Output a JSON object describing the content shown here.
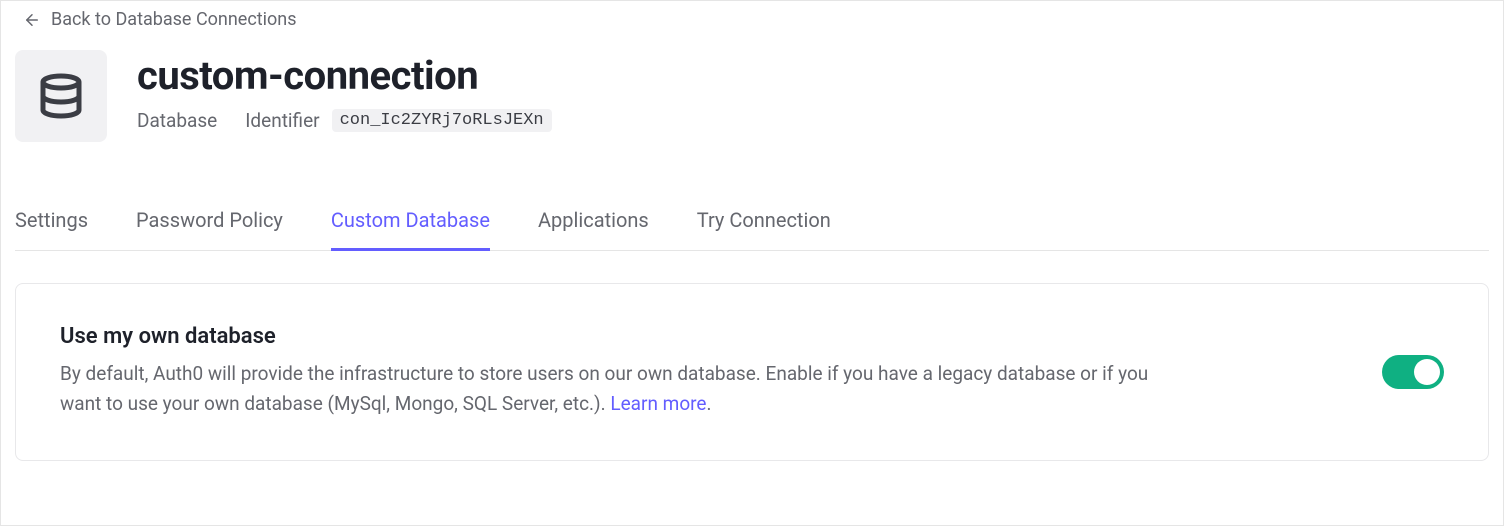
{
  "back": {
    "label": "Back to Database Connections"
  },
  "header": {
    "title": "custom-connection",
    "type_label": "Database",
    "identifier_label": "Identifier",
    "identifier_value": "con_Ic2ZYRj7oRLsJEXn"
  },
  "tabs": [
    {
      "label": "Settings",
      "active": false
    },
    {
      "label": "Password Policy",
      "active": false
    },
    {
      "label": "Custom Database",
      "active": true
    },
    {
      "label": "Applications",
      "active": false
    },
    {
      "label": "Try Connection",
      "active": false
    }
  ],
  "card": {
    "title": "Use my own database",
    "description": "By default, Auth0 will provide the infrastructure to store users on our own database. Enable if you have a legacy database or if you want to use your own database (MySql, Mongo, SQL Server, etc.). ",
    "learn_more": "Learn more",
    "period": ".",
    "toggle_on": true
  }
}
